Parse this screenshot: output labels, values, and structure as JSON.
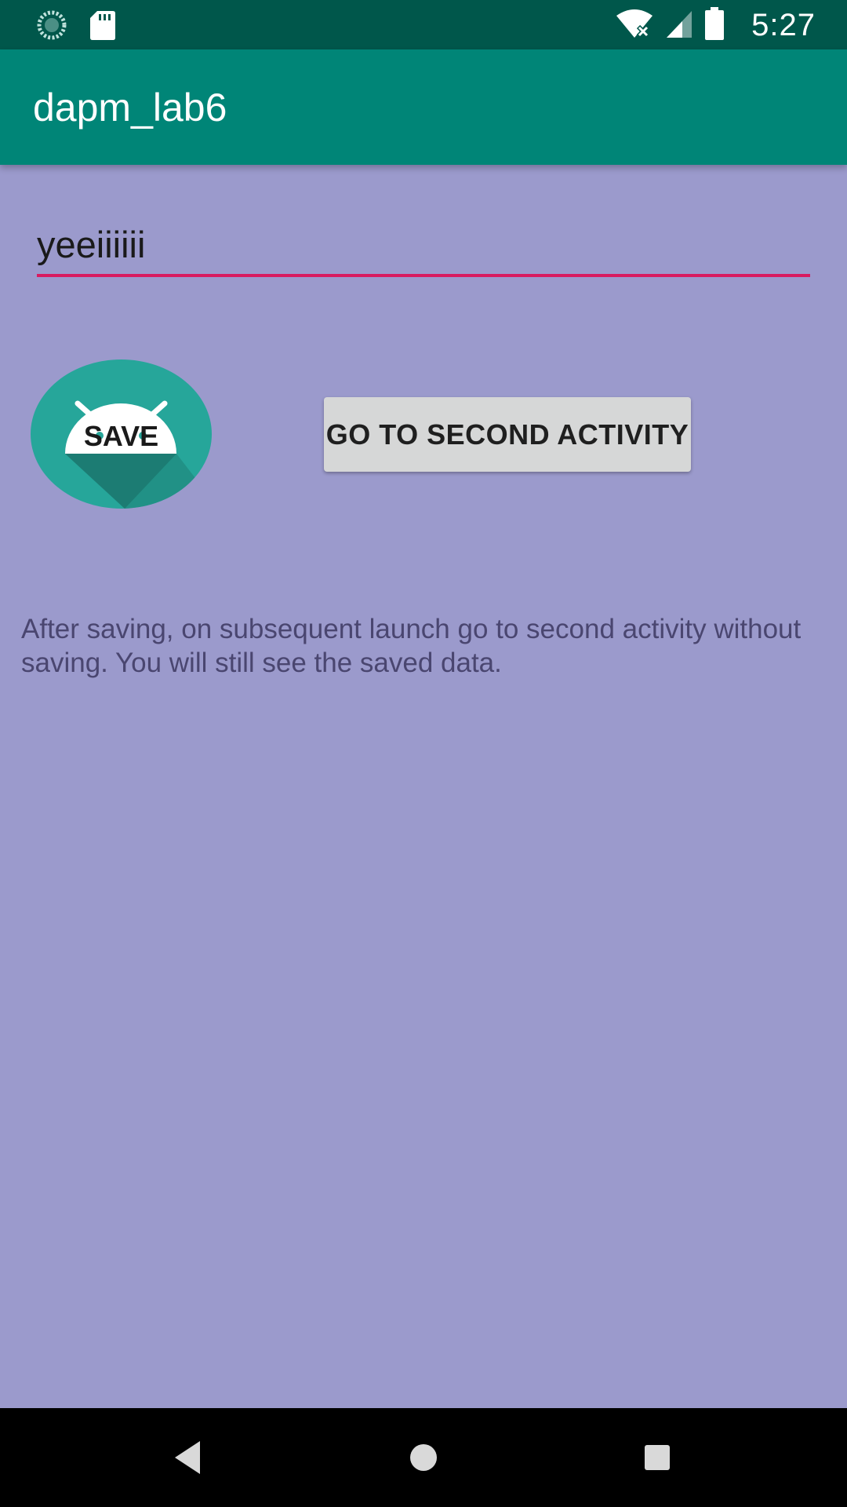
{
  "status_bar": {
    "time": "5:27",
    "icons": [
      "sync-icon",
      "sd-card-icon",
      "wifi-off-icon",
      "signal-icon",
      "battery-icon"
    ]
  },
  "app_bar": {
    "title": "dapm_lab6"
  },
  "edit_field": {
    "value": "yeeiiiiii"
  },
  "save_button": {
    "label": "SAVE",
    "icon": "android-icon"
  },
  "second_activity_button": {
    "label": "GO TO SECOND ACTIVITY"
  },
  "info_text": "After saving, on subsequent launch go to second activity without saving. You will still see the saved data.",
  "navigation_bar": {
    "buttons": [
      "back-icon",
      "home-icon",
      "recents-icon"
    ]
  },
  "colors": {
    "status_bar": "#00574b",
    "app_bar": "#008577",
    "background": "#9b9acc",
    "accent_underline": "#d81b60",
    "button": "#d6d7d7",
    "icon_teal": "#26a69a"
  }
}
